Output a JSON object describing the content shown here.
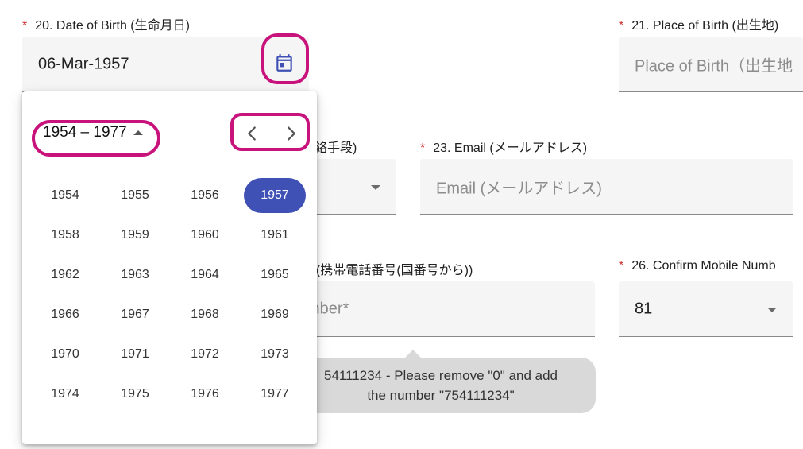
{
  "dob": {
    "required_mark": "*",
    "label": "20. Date of Birth (生命月日)",
    "value": "06-Mar-1957"
  },
  "place_of_birth": {
    "required_mark": "*",
    "label": "21. Place of Birth (出生地)",
    "placeholder": "Place of Birth（出生地"
  },
  "contact_method": {
    "label_partial": "絡手段)"
  },
  "email": {
    "required_mark": "*",
    "label": "23. Email (メールアドレス)",
    "placeholder": "Email (メールアドレス)"
  },
  "mobile": {
    "label_partial": "(携帯電話番号(国番号から))",
    "placeholder_partial": "mber*"
  },
  "confirm_mobile": {
    "required_mark": "*",
    "label": "26. Confirm Mobile Numb",
    "value": "81"
  },
  "tooltip": {
    "line1": "54111234 - Please remove \"0\" and add",
    "line2": "the number \"754111234\""
  },
  "picker": {
    "period_label": "1954 – 1977",
    "selected_year": "1957",
    "years": [
      "1954",
      "1955",
      "1956",
      "1957",
      "1958",
      "1959",
      "1960",
      "1961",
      "1962",
      "1963",
      "1964",
      "1965",
      "1966",
      "1967",
      "1968",
      "1969",
      "1970",
      "1971",
      "1972",
      "1973",
      "1974",
      "1975",
      "1976",
      "1977"
    ]
  },
  "colors": {
    "accent": "#3f51b5",
    "required": "#d32f2f",
    "annotation": "#c8137d",
    "field_bg": "#f5f5f5",
    "tooltip_bg": "#d9d9d9"
  },
  "icons": {
    "calendar": "calendar-icon",
    "previous": "chevron-left-icon",
    "next": "chevron-right-icon",
    "dropdown": "caret-down-icon",
    "period_toggle": "caret-up-icon"
  }
}
